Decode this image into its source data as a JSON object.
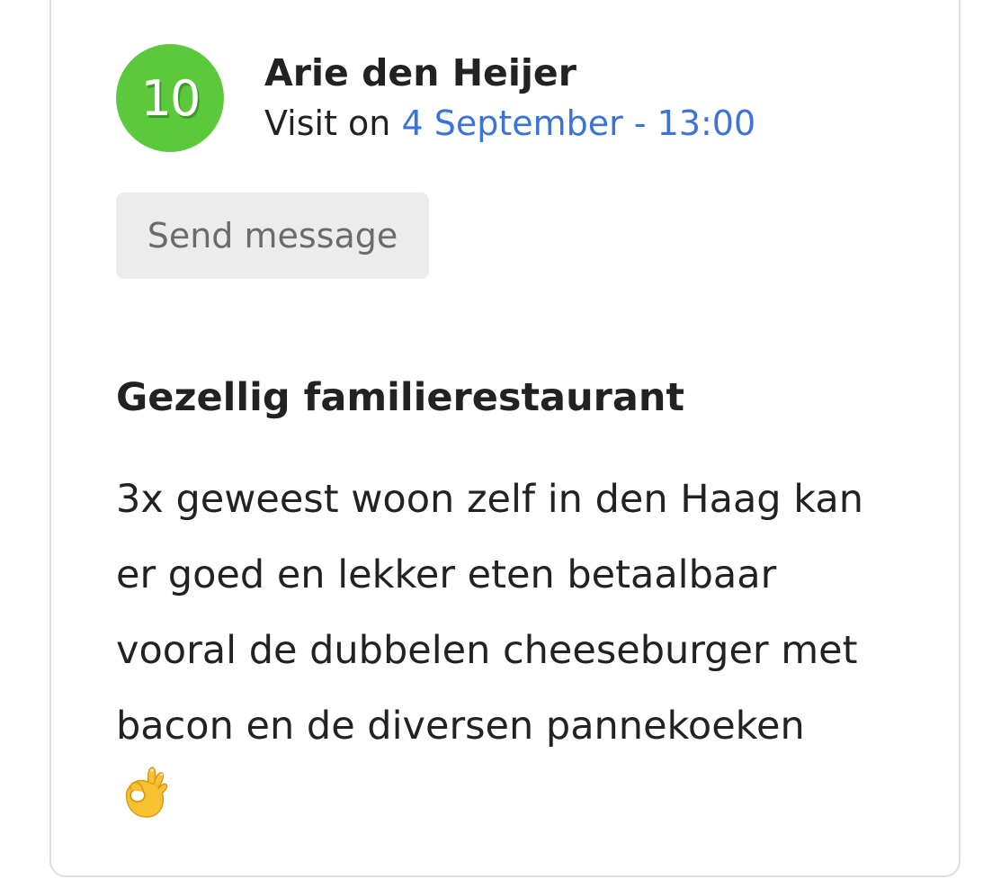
{
  "review": {
    "score": "10",
    "reviewer_name": "Arie den Heijer",
    "visit_prefix": "Visit on",
    "visit_date": "4 September - 13:00",
    "send_message_label": "Send message",
    "title": "Gezellig familierestaurant",
    "body_lines": [
      "3x geweest woon zelf in den Haag kan",
      "er goed en lekker eten betaalbaar",
      "vooral de dubbelen cheeseburger met",
      "bacon en de diversen pannekoeken"
    ],
    "emoji": "ok-hand-icon"
  },
  "colors": {
    "score_badge": "#5cc93c",
    "date_link": "#3b73d9",
    "button_bg": "#ececec",
    "button_text": "#6b6b6b",
    "card_border": "#dedede",
    "text": "#222222"
  }
}
